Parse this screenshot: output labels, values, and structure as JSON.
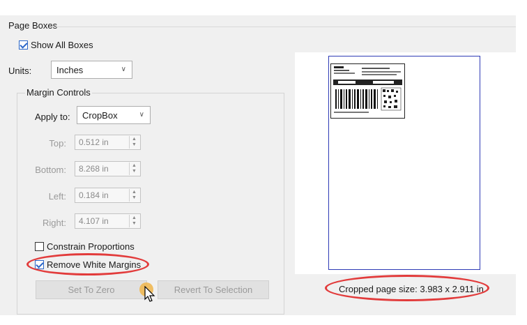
{
  "page_boxes": {
    "title": "Page Boxes",
    "show_all_boxes": {
      "label": "Show All Boxes",
      "checked": true
    }
  },
  "units": {
    "label": "Units:",
    "value": "Inches"
  },
  "margin_controls": {
    "title": "Margin Controls",
    "apply_to": {
      "label": "Apply to:",
      "value": "CropBox"
    },
    "fields": [
      {
        "label": "Top:",
        "value": "0.512 in"
      },
      {
        "label": "Bottom:",
        "value": "8.268 in"
      },
      {
        "label": "Left:",
        "value": "0.184 in"
      },
      {
        "label": "Right:",
        "value": "4.107 in"
      }
    ],
    "constrain_proportions": {
      "label": "Constrain Proportions",
      "checked": false
    },
    "remove_white_margins": {
      "label": "Remove White Margins",
      "checked": true
    },
    "set_to_zero": "Set To Zero",
    "revert_to_selection": "Revert To Selection"
  },
  "preview": {
    "cropped_size": "Cropped page size: 3.983 x 2.911 in"
  },
  "colors": {
    "highlight": "#e23b3b",
    "page_border": "#2d3ab5",
    "checkbox": "#2a66c8"
  }
}
